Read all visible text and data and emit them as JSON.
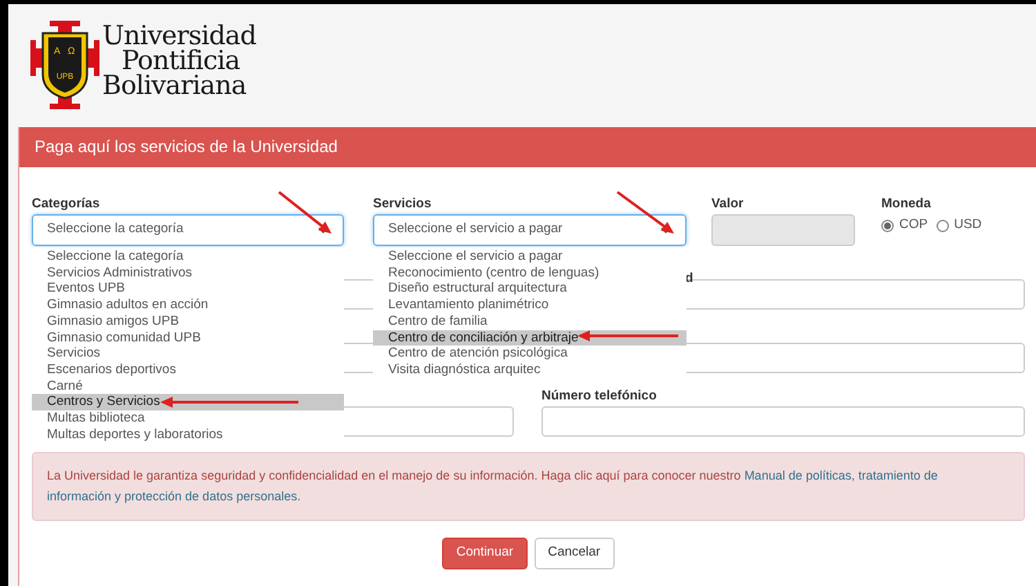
{
  "logo": {
    "emblem_letters": [
      "A",
      "Ω",
      "UPB"
    ],
    "lines": [
      "Universidad",
      "Pontificia",
      "Bolivariana"
    ]
  },
  "panel": {
    "title": "Paga aquí los servicios de la Universidad"
  },
  "form": {
    "categoria": {
      "label": "Categorías",
      "value": "Seleccione la categoría",
      "options": [
        {
          "label": "Seleccione la categoría",
          "highlighted": false
        },
        {
          "label": "Servicios Administrativos",
          "highlighted": false
        },
        {
          "label": "Eventos UPB",
          "highlighted": false
        },
        {
          "label": "Gimnasio adultos en acción",
          "highlighted": false
        },
        {
          "label": "Gimnasio amigos UPB",
          "highlighted": false
        },
        {
          "label": "Gimnasio comunidad UPB",
          "highlighted": false
        },
        {
          "label": "Servicios",
          "highlighted": false
        },
        {
          "label": "Escenarios deportivos",
          "highlighted": false
        },
        {
          "label": "Carné",
          "highlighted": false
        },
        {
          "label": "Centros y Servicios",
          "highlighted": true
        },
        {
          "label": "Multas biblioteca",
          "highlighted": false
        },
        {
          "label": "Multas deportes y laboratorios",
          "highlighted": false
        }
      ]
    },
    "servicio": {
      "label": "Servicios",
      "value": "Seleccione el servicio a pagar",
      "options": [
        {
          "label": "Seleccione el servicio a pagar",
          "highlighted": false
        },
        {
          "label": "Reconocimiento (centro de lenguas)",
          "highlighted": false
        },
        {
          "label": "Diseño estructural arquitectura",
          "highlighted": false
        },
        {
          "label": "Levantamiento planimétrico",
          "highlighted": false
        },
        {
          "label": "Centro de familia",
          "highlighted": false
        },
        {
          "label": "Centro de conciliación y arbitraje",
          "highlighted": true
        },
        {
          "label": "Centro de atención psicológica",
          "highlighted": false
        },
        {
          "label": "Visita diagnóstica arquitec",
          "highlighted": false
        }
      ]
    },
    "valor": {
      "label": "Valor",
      "disabled": true
    },
    "moneda": {
      "label": "Moneda",
      "options": [
        {
          "label": "COP",
          "selected": true
        },
        {
          "label": "USD",
          "selected": false
        }
      ]
    },
    "partial_label": "d",
    "telefono": {
      "label": "Número telefónico"
    }
  },
  "notice": {
    "text": "La Universidad le garantiza seguridad y confidencialidad en el manejo de su información. Haga clic aquí para conocer nuestro ",
    "link_lines": [
      "Manual de políticas, tratamiento de",
      "información y protección de datos personales."
    ]
  },
  "buttons": [
    {
      "label": "Continuar",
      "kind": "primary"
    },
    {
      "label": "Cancelar",
      "kind": "secondary"
    }
  ]
}
